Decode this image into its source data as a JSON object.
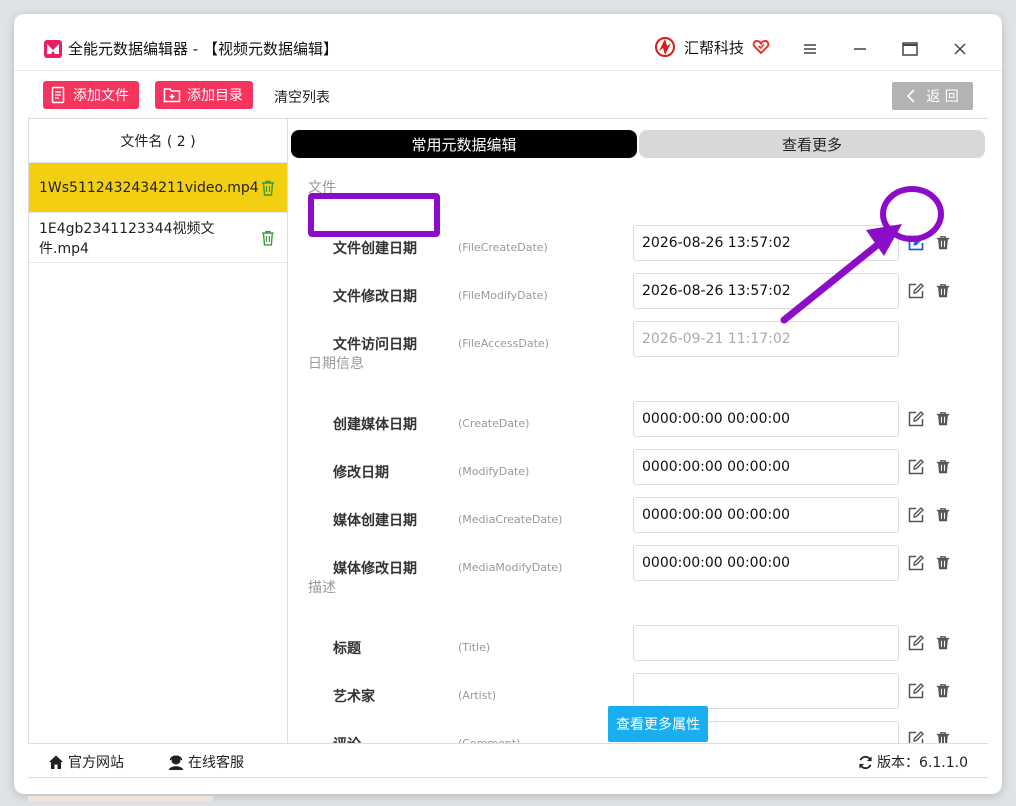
{
  "window": {
    "title": "全能元数据编辑器 - 【视频元数据编辑】",
    "brand_name": "汇帮科技"
  },
  "toolbar": {
    "add_file_label": "添加文件",
    "add_folder_label": "添加目录",
    "clear_list_label": "清空列表",
    "back_label": "返 回"
  },
  "file_list": {
    "header": "文件名 ( 2 )",
    "items": [
      {
        "name": "1Ws5112432434211video.mp4",
        "selected": true
      },
      {
        "name": "1E4gb2341123344视频文件.mp4",
        "selected": false
      }
    ]
  },
  "tabs": {
    "common_label": "常用元数据编辑",
    "more_label": "查看更多"
  },
  "sections": {
    "file_label": "文件",
    "date_label": "日期信息",
    "desc_label": "描述"
  },
  "rows": [
    {
      "label": "文件创建日期",
      "key": "(FileCreateDate)",
      "value": "2026-08-26 13:57:02",
      "placeholder": ""
    },
    {
      "label": "文件修改日期",
      "key": "(FileModifyDate)",
      "value": "2026-08-26 13:57:02",
      "placeholder": ""
    },
    {
      "label": "文件访问日期",
      "key": "(FileAccessDate)",
      "value": "",
      "placeholder": "2026-09-21 11:17:02"
    },
    {
      "label": "创建媒体日期",
      "key": "(CreateDate)",
      "value": "0000:00:00 00:00:00",
      "placeholder": ""
    },
    {
      "label": "修改日期",
      "key": "(ModifyDate)",
      "value": "0000:00:00 00:00:00",
      "placeholder": ""
    },
    {
      "label": "媒体创建日期",
      "key": "(MediaCreateDate)",
      "value": "0000:00:00 00:00:00",
      "placeholder": ""
    },
    {
      "label": "媒体修改日期",
      "key": "(MediaModifyDate)",
      "value": "0000:00:00 00:00:00",
      "placeholder": ""
    },
    {
      "label": "标题",
      "key": "(Title)",
      "value": "",
      "placeholder": ""
    },
    {
      "label": "艺术家",
      "key": "(Artist)",
      "value": "",
      "placeholder": ""
    },
    {
      "label": "评论",
      "key": "(Comment)",
      "value": "",
      "placeholder": ""
    }
  ],
  "more_props_label": "查看更多属性",
  "bottom": {
    "website_label": "官方网站",
    "support_label": "在线客服",
    "version_label": "版本：6.1.1.0"
  },
  "colors": {
    "accent_pink": "#f7345e",
    "selected_yellow": "#f3cf11",
    "annotation_purple": "#8c0cc7",
    "more_button_blue": "#18aef0"
  }
}
